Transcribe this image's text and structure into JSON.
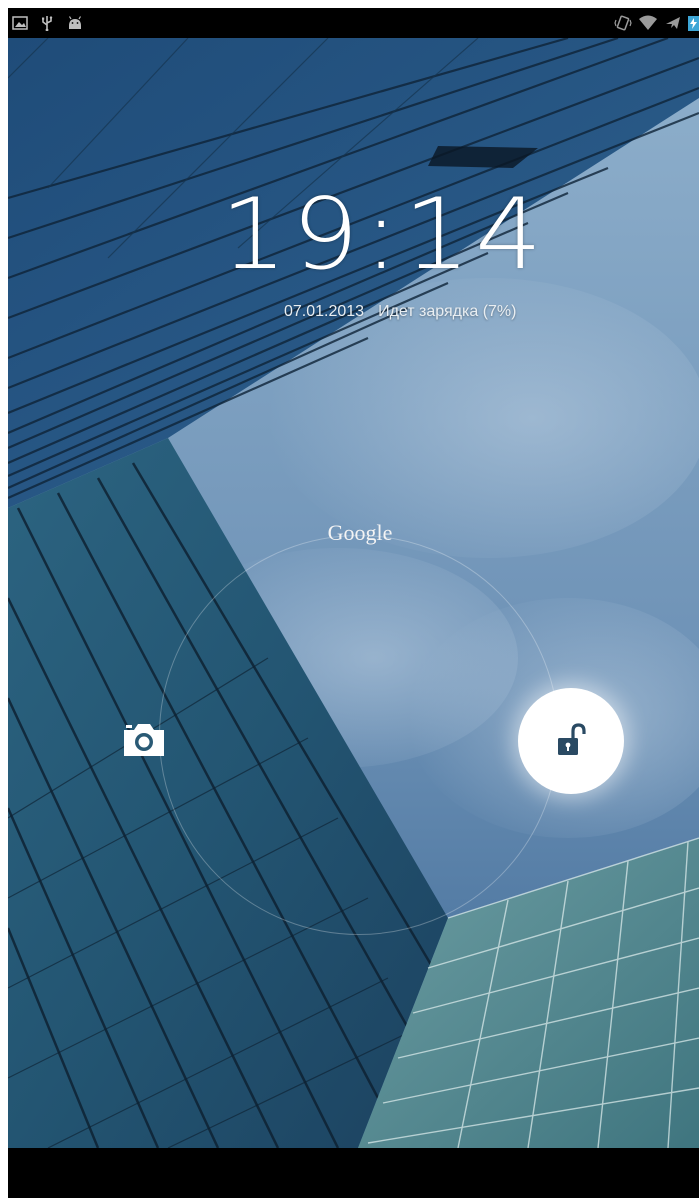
{
  "status_bar": {
    "left_icons": [
      "gallery-icon",
      "usb-icon",
      "android-debug-icon"
    ],
    "right_icons": [
      "vibrate-icon",
      "wifi-icon",
      "airplane-mode-icon",
      "battery-charging-icon"
    ]
  },
  "lockscreen": {
    "time": "19:14",
    "date": "07.01.2013",
    "charging_status": "Идет зарядка (7%)",
    "targets": {
      "google_label": "Google",
      "camera_icon": "camera-icon",
      "unlock_icon": "unlock-icon"
    }
  },
  "colors": {
    "sky": "#6f93b7",
    "building_dark": "#1c3b55",
    "glass_teal": "#3e7184",
    "handle": "#ffffff",
    "lock_icon": "#2a4a63"
  }
}
